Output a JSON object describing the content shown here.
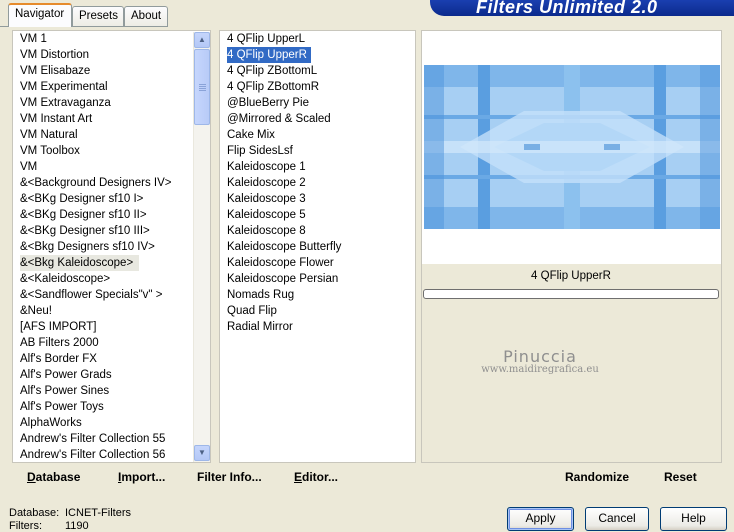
{
  "app": {
    "title": "Filters Unlimited 2.0"
  },
  "tabs": [
    "Navigator",
    "Presets",
    "About"
  ],
  "categories": [
    "VM 1",
    "VM Distortion",
    "VM Elisabaze",
    "VM Experimental",
    "VM Extravaganza",
    "VM Instant Art",
    "VM Natural",
    "VM Toolbox",
    "VM",
    "&<Background Designers IV>",
    "&<BKg Designer sf10 I>",
    "&<BKg Designer sf10 II>",
    "&<BKg Designer sf10 III>",
    "&<Bkg Designers sf10 IV>",
    "&<Bkg Kaleidoscope>",
    "&<Kaleidoscope>",
    "&<Sandflower Specials\"v\" >",
    "&Neu!",
    "[AFS IMPORT]",
    "AB Filters 2000",
    "Alf's Border FX",
    "Alf's Power Grads",
    "Alf's Power Sines",
    "Alf's Power Toys",
    "AlphaWorks",
    "Andrew's Filter Collection 55",
    "Andrew's Filter Collection 56"
  ],
  "selected_category": "&<Bkg Kaleidoscope>",
  "filters": [
    "4 QFlip UpperL",
    "4 QFlip UpperR",
    "4 QFlip ZBottomL",
    "4 QFlip ZBottomR",
    "@BlueBerry Pie",
    "@Mirrored & Scaled",
    "Cake Mix",
    "Flip SidesLsf",
    "Kaleidoscope 1",
    "Kaleidoscope 2",
    "Kaleidoscope 3",
    "Kaleidoscope 5",
    "Kaleidoscope 8",
    "Kaleidoscope Butterfly",
    "Kaleidoscope Flower",
    "Kaleidoscope Persian",
    "Nomads Rug",
    "Quad Flip",
    "Radial Mirror"
  ],
  "selected_filter": "4 QFlip UpperR",
  "preview": {
    "filter_name": "4 QFlip UpperR",
    "progress": 0
  },
  "watermark": {
    "line1": "Pinuccia",
    "line2": "www.maidiregrafica.eu"
  },
  "toolbar": {
    "database": "Database",
    "import": "Import...",
    "filter_info": "Filter Info...",
    "editor": "Editor...",
    "randomize": "Randomize",
    "reset": "Reset"
  },
  "status": {
    "database_label": "Database:",
    "database_value": "ICNET-Filters",
    "filters_label": "Filters:",
    "filters_value": "1190"
  },
  "buttons": {
    "apply": "Apply",
    "cancel": "Cancel",
    "help": "Help"
  },
  "colors": {
    "selection": "#316ac5",
    "banner": "#0b2a8c",
    "preview_light": "#a9d1f4",
    "preview_dark": "#4a8fd6"
  }
}
